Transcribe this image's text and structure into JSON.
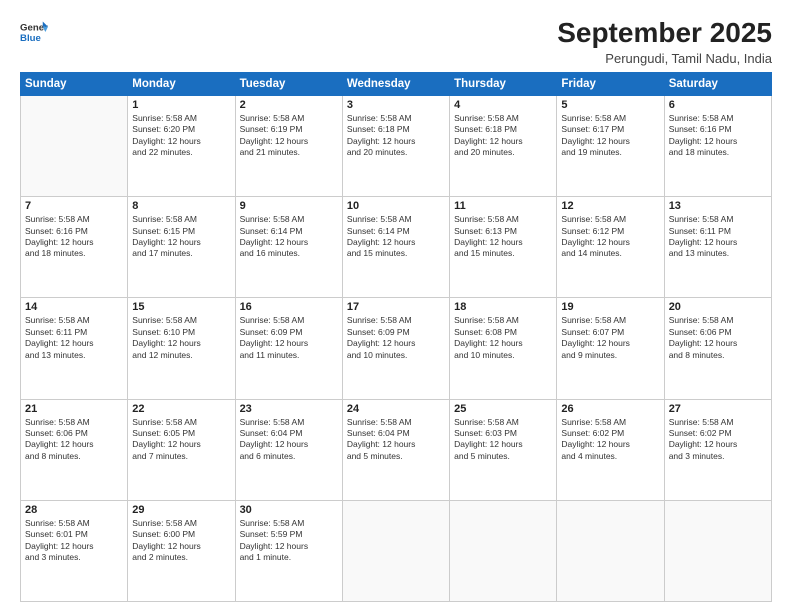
{
  "header": {
    "logo_line1": "General",
    "logo_line2": "Blue",
    "month_title": "September 2025",
    "subtitle": "Perungudi, Tamil Nadu, India"
  },
  "days_of_week": [
    "Sunday",
    "Monday",
    "Tuesday",
    "Wednesday",
    "Thursday",
    "Friday",
    "Saturday"
  ],
  "weeks": [
    [
      {
        "day": "",
        "info": ""
      },
      {
        "day": "1",
        "info": "Sunrise: 5:58 AM\nSunset: 6:20 PM\nDaylight: 12 hours\nand 22 minutes."
      },
      {
        "day": "2",
        "info": "Sunrise: 5:58 AM\nSunset: 6:19 PM\nDaylight: 12 hours\nand 21 minutes."
      },
      {
        "day": "3",
        "info": "Sunrise: 5:58 AM\nSunset: 6:18 PM\nDaylight: 12 hours\nand 20 minutes."
      },
      {
        "day": "4",
        "info": "Sunrise: 5:58 AM\nSunset: 6:18 PM\nDaylight: 12 hours\nand 20 minutes."
      },
      {
        "day": "5",
        "info": "Sunrise: 5:58 AM\nSunset: 6:17 PM\nDaylight: 12 hours\nand 19 minutes."
      },
      {
        "day": "6",
        "info": "Sunrise: 5:58 AM\nSunset: 6:16 PM\nDaylight: 12 hours\nand 18 minutes."
      }
    ],
    [
      {
        "day": "7",
        "info": "Sunrise: 5:58 AM\nSunset: 6:16 PM\nDaylight: 12 hours\nand 18 minutes."
      },
      {
        "day": "8",
        "info": "Sunrise: 5:58 AM\nSunset: 6:15 PM\nDaylight: 12 hours\nand 17 minutes."
      },
      {
        "day": "9",
        "info": "Sunrise: 5:58 AM\nSunset: 6:14 PM\nDaylight: 12 hours\nand 16 minutes."
      },
      {
        "day": "10",
        "info": "Sunrise: 5:58 AM\nSunset: 6:14 PM\nDaylight: 12 hours\nand 15 minutes."
      },
      {
        "day": "11",
        "info": "Sunrise: 5:58 AM\nSunset: 6:13 PM\nDaylight: 12 hours\nand 15 minutes."
      },
      {
        "day": "12",
        "info": "Sunrise: 5:58 AM\nSunset: 6:12 PM\nDaylight: 12 hours\nand 14 minutes."
      },
      {
        "day": "13",
        "info": "Sunrise: 5:58 AM\nSunset: 6:11 PM\nDaylight: 12 hours\nand 13 minutes."
      }
    ],
    [
      {
        "day": "14",
        "info": "Sunrise: 5:58 AM\nSunset: 6:11 PM\nDaylight: 12 hours\nand 13 minutes."
      },
      {
        "day": "15",
        "info": "Sunrise: 5:58 AM\nSunset: 6:10 PM\nDaylight: 12 hours\nand 12 minutes."
      },
      {
        "day": "16",
        "info": "Sunrise: 5:58 AM\nSunset: 6:09 PM\nDaylight: 12 hours\nand 11 minutes."
      },
      {
        "day": "17",
        "info": "Sunrise: 5:58 AM\nSunset: 6:09 PM\nDaylight: 12 hours\nand 10 minutes."
      },
      {
        "day": "18",
        "info": "Sunrise: 5:58 AM\nSunset: 6:08 PM\nDaylight: 12 hours\nand 10 minutes."
      },
      {
        "day": "19",
        "info": "Sunrise: 5:58 AM\nSunset: 6:07 PM\nDaylight: 12 hours\nand 9 minutes."
      },
      {
        "day": "20",
        "info": "Sunrise: 5:58 AM\nSunset: 6:06 PM\nDaylight: 12 hours\nand 8 minutes."
      }
    ],
    [
      {
        "day": "21",
        "info": "Sunrise: 5:58 AM\nSunset: 6:06 PM\nDaylight: 12 hours\nand 8 minutes."
      },
      {
        "day": "22",
        "info": "Sunrise: 5:58 AM\nSunset: 6:05 PM\nDaylight: 12 hours\nand 7 minutes."
      },
      {
        "day": "23",
        "info": "Sunrise: 5:58 AM\nSunset: 6:04 PM\nDaylight: 12 hours\nand 6 minutes."
      },
      {
        "day": "24",
        "info": "Sunrise: 5:58 AM\nSunset: 6:04 PM\nDaylight: 12 hours\nand 5 minutes."
      },
      {
        "day": "25",
        "info": "Sunrise: 5:58 AM\nSunset: 6:03 PM\nDaylight: 12 hours\nand 5 minutes."
      },
      {
        "day": "26",
        "info": "Sunrise: 5:58 AM\nSunset: 6:02 PM\nDaylight: 12 hours\nand 4 minutes."
      },
      {
        "day": "27",
        "info": "Sunrise: 5:58 AM\nSunset: 6:02 PM\nDaylight: 12 hours\nand 3 minutes."
      }
    ],
    [
      {
        "day": "28",
        "info": "Sunrise: 5:58 AM\nSunset: 6:01 PM\nDaylight: 12 hours\nand 3 minutes."
      },
      {
        "day": "29",
        "info": "Sunrise: 5:58 AM\nSunset: 6:00 PM\nDaylight: 12 hours\nand 2 minutes."
      },
      {
        "day": "30",
        "info": "Sunrise: 5:58 AM\nSunset: 5:59 PM\nDaylight: 12 hours\nand 1 minute."
      },
      {
        "day": "",
        "info": ""
      },
      {
        "day": "",
        "info": ""
      },
      {
        "day": "",
        "info": ""
      },
      {
        "day": "",
        "info": ""
      }
    ]
  ]
}
